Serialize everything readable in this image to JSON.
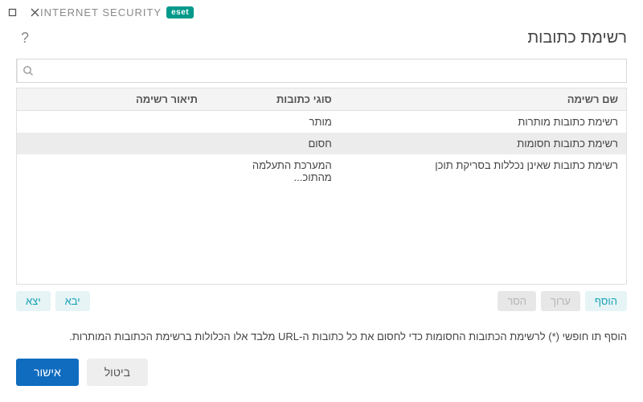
{
  "brand": {
    "badge": "eset",
    "product": "INTERNET SECURITY"
  },
  "header": {
    "title": "רשימת כתובות"
  },
  "search": {
    "placeholder": ""
  },
  "table": {
    "columns": {
      "name": "שם רשימה",
      "type": "סוגי כתובות",
      "desc": "תיאור רשימה"
    },
    "rows": [
      {
        "name": "רשימת כתובות מותרות",
        "type": "מותר",
        "desc": ""
      },
      {
        "name": "רשימת כתובות חסומות",
        "type": "חסום",
        "desc": ""
      },
      {
        "name": "רשימת כתובות שאינן נכללות בסריקת תוכן",
        "type": "המערכת התעלמה מהתוכ...",
        "desc": ""
      }
    ]
  },
  "toolbar": {
    "add": "הוסף",
    "edit": "ערוך",
    "remove": "הסר",
    "import": "יבא",
    "export": "יצא"
  },
  "hint": "הוסף תו חופשי (*) לרשימת הכתובות החסומות כדי לחסום את כל כתובות ה-URL מלבד אלו הכלולות ברשימת הכתובות המותרות.",
  "footer": {
    "ok": "אישור",
    "cancel": "ביטול"
  }
}
